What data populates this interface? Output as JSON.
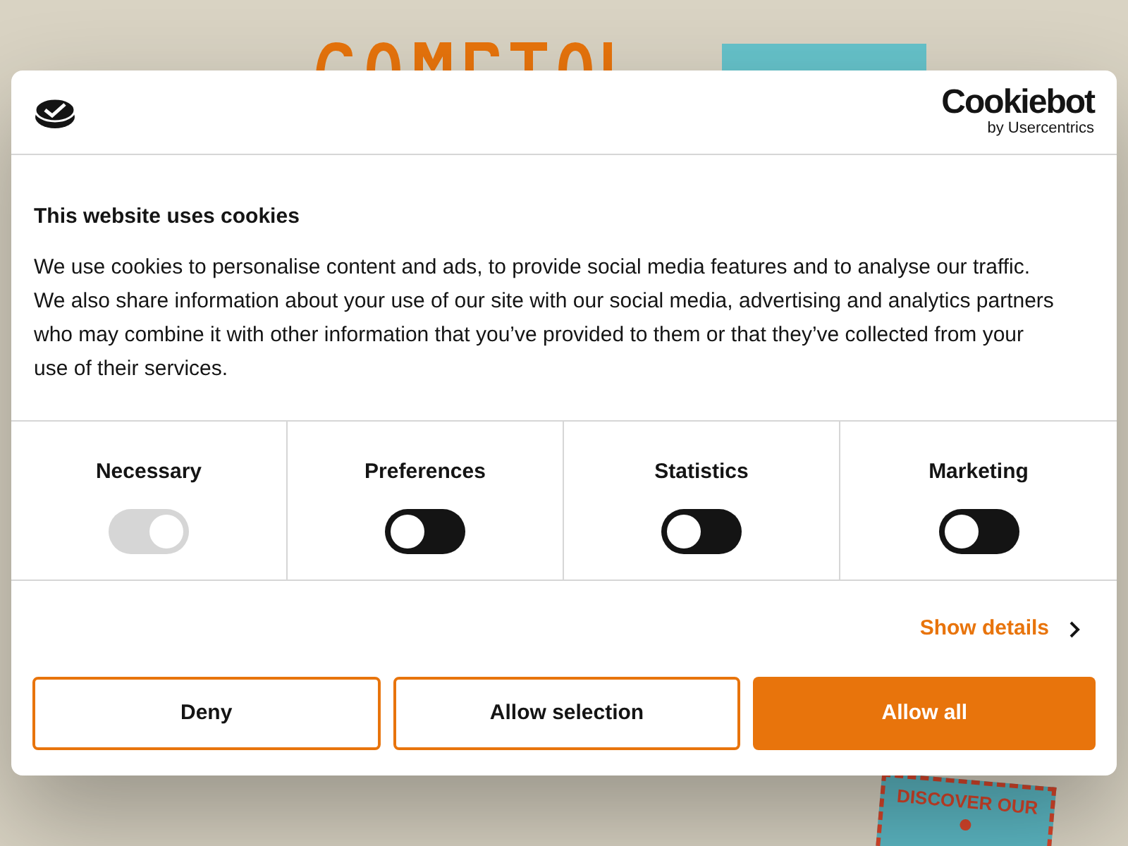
{
  "background_page": {
    "stamp": {
      "top_text": "DISCOVER OUR"
    }
  },
  "dialog": {
    "brand": {
      "name": "Cookiebot",
      "byline": "by Usercentrics"
    },
    "title": "This website uses cookies",
    "description": "We use cookies to personalise content and ads, to provide social media features and to analyse our traffic. We also share information about your use of our site with our social media, advertising and analytics partners who may combine it with other information that you’ve provided to them or that they’ve collected from your use of their services.",
    "categories": [
      {
        "label": "Necessary",
        "on": true,
        "disabled": true
      },
      {
        "label": "Preferences",
        "on": false,
        "disabled": false
      },
      {
        "label": "Statistics",
        "on": false,
        "disabled": false
      },
      {
        "label": "Marketing",
        "on": false,
        "disabled": false
      }
    ],
    "show_details": "Show details",
    "buttons": [
      {
        "label": "Deny",
        "kind": "outline"
      },
      {
        "label": "Allow selection",
        "kind": "outline"
      },
      {
        "label": "Allow all",
        "kind": "filled"
      }
    ]
  }
}
